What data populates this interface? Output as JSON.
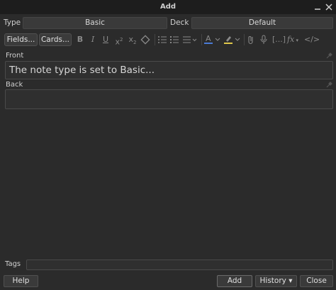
{
  "window": {
    "title": "Add"
  },
  "type_row": {
    "type_label": "Type",
    "type_value": "Basic",
    "deck_label": "Deck",
    "deck_value": "Default"
  },
  "toolbar": {
    "fields_label": "Fields...",
    "cards_label": "Cards...",
    "icons": [
      "bold-icon",
      "italic-icon",
      "underline-icon",
      "superscript-icon",
      "subscript-icon",
      "eraser-icon",
      "unordered-list-icon",
      "ordered-list-icon",
      "align-icon",
      "text-color-icon",
      "highlight-icon",
      "attach-icon",
      "record-icon",
      "cloze-icon",
      "mathjax-icon",
      "html-editor-icon"
    ]
  },
  "fields": {
    "front_label": "Front",
    "front_value": "The note type is set to Basic...",
    "back_label": "Back",
    "back_value": ""
  },
  "tags": {
    "label": "Tags",
    "value": ""
  },
  "bottom": {
    "help_label": "Help",
    "add_label": "Add",
    "history_label": "History ▾",
    "close_label": "Close"
  },
  "colors": {
    "text_color_accent": "#4a7bd6",
    "highlight_accent": "#e0c84a",
    "background": "#2b2b2b"
  }
}
